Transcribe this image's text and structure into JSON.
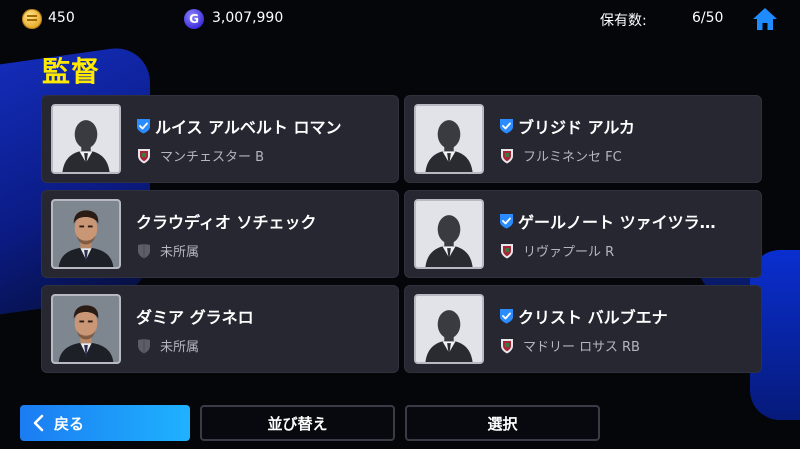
{
  "topbar": {
    "coins": "450",
    "gp": "3,007,990",
    "gp_icon_letter": "G",
    "owned_label": "保有数:",
    "owned_value": "6/50",
    "icons": [
      "coin-icon",
      "gp-icon",
      "home-icon"
    ]
  },
  "title": "監督",
  "managers": [
    {
      "name": "ルイス アルベルト ロマン",
      "club": "マンチェスター B",
      "verified": true,
      "portrait": "silhouette",
      "club_icon": "crest-icon"
    },
    {
      "name": "ブリジド アルカ",
      "club": "フルミネンセ FC",
      "verified": true,
      "portrait": "silhouette",
      "club_icon": "crest-icon"
    },
    {
      "name": "クラウディオ ソチェック",
      "club": "未所属",
      "verified": false,
      "portrait": "photo",
      "club_icon": "shield-gray-icon"
    },
    {
      "name": "ゲールノート ツァイツラ…",
      "club": "リヴァプール R",
      "verified": true,
      "portrait": "silhouette",
      "club_icon": "crest-icon"
    },
    {
      "name": "ダミア グラネロ",
      "club": "未所属",
      "verified": false,
      "portrait": "photo",
      "club_icon": "shield-gray-icon"
    },
    {
      "name": "クリスト バルブエナ",
      "club": "マドリー ロサス RB",
      "verified": true,
      "portrait": "silhouette",
      "club_icon": "crest-icon"
    }
  ],
  "buttons": {
    "back": "戻る",
    "sort": "並び替え",
    "select": "選択"
  },
  "colors": {
    "title": "#ffe900",
    "card_bg": "#262731",
    "verified": "#2a8cff",
    "back_button": "#1b7cf2"
  }
}
